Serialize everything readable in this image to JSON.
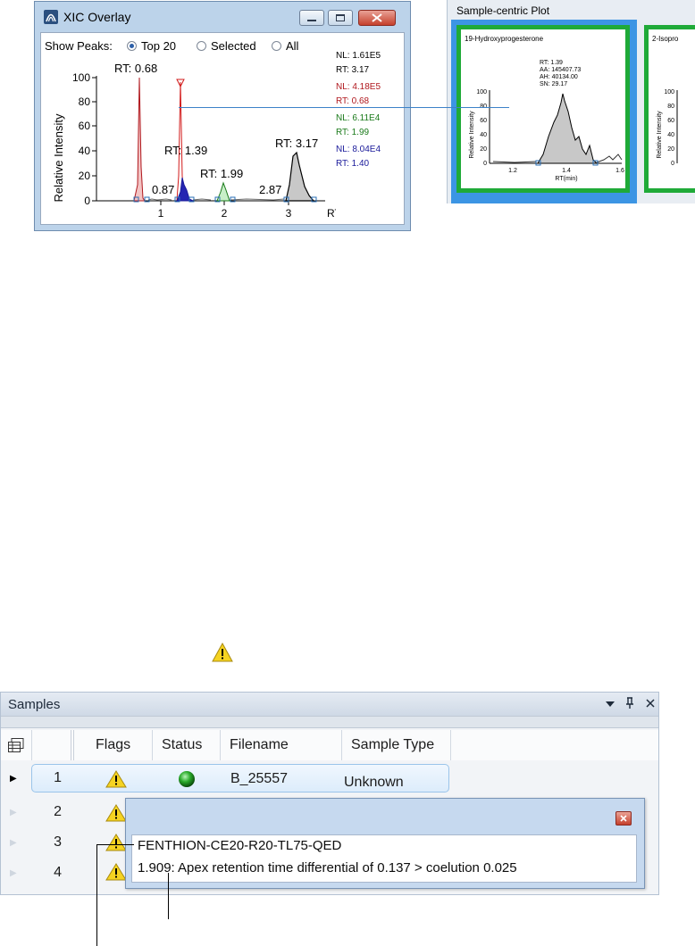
{
  "xic": {
    "title": "XIC Overlay",
    "show_peaks_label": "Show Peaks:",
    "options": [
      "Top 20",
      "Selected",
      "All"
    ],
    "selected_option": "Top 20",
    "ylabel": "Relative Intensity",
    "xlabel": "RT(min)",
    "yticks": [
      "100",
      "80",
      "60",
      "40",
      "20",
      "0"
    ],
    "xticks": [
      "1",
      "2",
      "3"
    ],
    "peak_labels": [
      "RT: 0.68",
      "RT: 1.39",
      "RT: 1.99",
      "RT: 3.17",
      "0.87",
      "2.87"
    ],
    "legend": [
      {
        "nl": "NL: 1.61E5",
        "rt": "RT: 3.17",
        "color": "#000000"
      },
      {
        "nl": "NL: 4.18E5",
        "rt": "RT: 0.68",
        "color": "#b0181e"
      },
      {
        "nl": "NL: 6.11E4",
        "rt": "RT: 1.99",
        "color": "#1a7a1a"
      },
      {
        "nl": "NL: 8.04E4",
        "rt": "RT: 1.40",
        "color": "#1a1a9a"
      }
    ]
  },
  "scp": {
    "title": "Sample-centric Plot",
    "panel1_title": "19-Hydroxyprogesterone",
    "panel2_title": "2-Isopro",
    "stats": [
      "RT: 1.39",
      "AA: 145407.73",
      "AH: 40134.00",
      "SN: 29.17"
    ],
    "ylabel": "Relative Intensity",
    "xlabel": "RT(min)",
    "yticks": [
      "100",
      "80",
      "60",
      "40",
      "20",
      "0"
    ],
    "xticks": [
      "1.2",
      "1.4",
      "1.6"
    ]
  },
  "samples": {
    "title": "Samples",
    "columns": [
      "Flags",
      "Status",
      "Filename",
      "Sample Type"
    ],
    "rows": [
      {
        "num": "1",
        "filename": "B_25557",
        "type": "Unknown"
      },
      {
        "num": "2"
      },
      {
        "num": "3"
      },
      {
        "num": "4"
      }
    ]
  },
  "tooltip": {
    "line1": "FENTHION-CE20-R20-TL75-QED",
    "line2": "1.909: Apex retention time differential of 0.137 > coelution 0.025"
  },
  "colors": {
    "accent_blue": "#3c95e4",
    "frame_green": "#1faa38",
    "status_green": "#1e8a1e",
    "warning_yellow": "#f5d321"
  }
}
